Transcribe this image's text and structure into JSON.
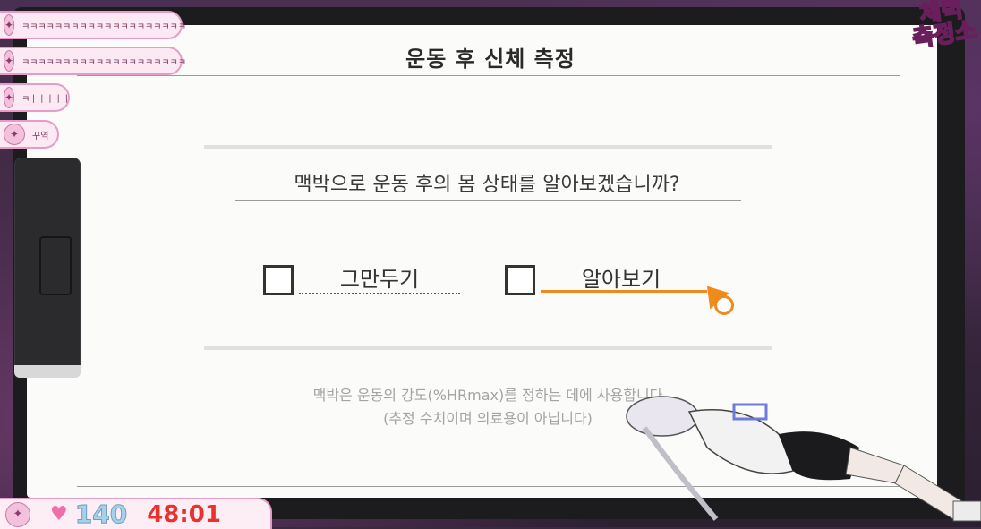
{
  "chat": {
    "messages": [
      {
        "icon": "controller-icon",
        "text": "ㅋㅋㅋㅋㅋㅋㅋㅋㅋㅋㅋㅋㅋㅋㅋㅋㅋㅋㅋㅋ"
      },
      {
        "icon": "controller-icon",
        "text": "ㅋㅋㅋㅋㅋㅋㅋㅋㅋㅋㅋㅋㅋㅋㅋㅋㅋㅋㅋㅋ"
      },
      {
        "icon": "controller-icon",
        "text": "ㅋㅏㅏㅏㅏㅏ"
      },
      {
        "icon": "controller-icon",
        "text": "꾸역"
      }
    ]
  },
  "logo": {
    "line1": "체력",
    "line2": "측정소"
  },
  "screen": {
    "title": "운동 후 신체 측정",
    "question": "맥박으로 운동 후의 몸 상태를 알아보겠습니까?",
    "options": [
      {
        "label": "그만두기",
        "checked": false
      },
      {
        "label": "알아보기",
        "checked": false,
        "highlighted": true
      }
    ],
    "footnote_line1": "맥박은 운동의 강도(%HRmax)를 정하는 데에 사용합니다",
    "footnote_line2": "(추정 수치이며 의료용이 아닙니다)"
  },
  "status": {
    "viewers": "140",
    "timer": "48:01"
  },
  "colors": {
    "accent_orange": "#f08a1c",
    "timer_red": "#e8322b",
    "viewer_blue": "#a7d0ea",
    "chat_pink": "#fde9f4"
  }
}
